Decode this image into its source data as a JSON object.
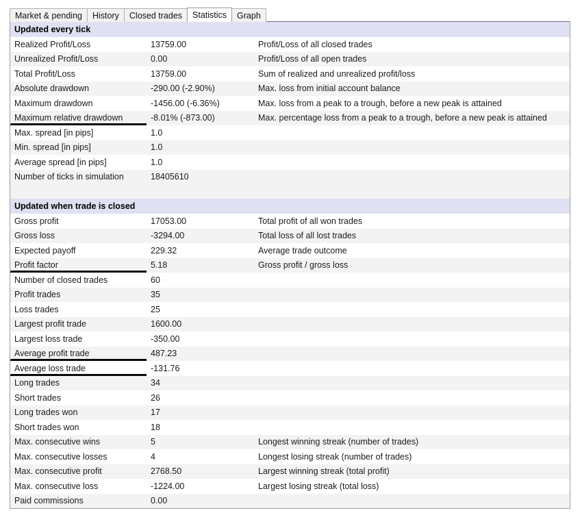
{
  "tabs": [
    {
      "label": "Market & pending",
      "active": false
    },
    {
      "label": "History",
      "active": false
    },
    {
      "label": "Closed trades",
      "active": false
    },
    {
      "label": "Statistics",
      "active": true
    },
    {
      "label": "Graph",
      "active": false
    }
  ],
  "colors": {
    "section_header_bg": "#dfe0f2",
    "row_alt_bg": "#f3f3f3",
    "row_bg": "#ffffff",
    "mark_color": "#0b0b0b",
    "border": "#9e9e9e"
  },
  "rows": [
    {
      "type": "section",
      "name": "Updated every tick",
      "value": "",
      "description": ""
    },
    {
      "type": "data",
      "name": "Realized Profit/Loss",
      "value": "13759.00",
      "description": "Profit/Loss of all closed trades"
    },
    {
      "type": "data",
      "name": "Unrealized Profit/Loss",
      "value": "0.00",
      "description": "Profit/Loss of all open trades"
    },
    {
      "type": "data",
      "name": "Total Profit/Loss",
      "value": "13759.00",
      "description": "Sum of realized and unrealized profit/loss"
    },
    {
      "type": "data",
      "name": "Absolute drawdown",
      "value": "-290.00 (-2.90%)",
      "description": "Max. loss from initial account balance"
    },
    {
      "type": "data",
      "name": "Maximum drawdown",
      "value": "-1456.00 (-6.36%)",
      "description": "Max. loss from a peak to a trough, before a new peak is attained"
    },
    {
      "type": "data",
      "name": "Maximum relative drawdown",
      "value": "-8.01% (-873.00)",
      "description": "Max. percentage loss from a peak to a trough, before a new peak is attained",
      "mark": "u-drawdown"
    },
    {
      "type": "data",
      "name": "Max. spread [in pips]",
      "value": "1.0",
      "description": ""
    },
    {
      "type": "data",
      "name": "Min. spread [in pips]",
      "value": "1.0",
      "description": ""
    },
    {
      "type": "data",
      "name": "Average spread [in pips]",
      "value": "1.0",
      "description": ""
    },
    {
      "type": "data",
      "name": "Number of ticks in simulation",
      "value": "18405610",
      "description": ""
    },
    {
      "type": "spacer",
      "name": "",
      "value": "",
      "description": ""
    },
    {
      "type": "section",
      "name": "Updated when trade is closed",
      "value": "",
      "description": ""
    },
    {
      "type": "data",
      "name": "Gross profit",
      "value": "17053.00",
      "description": "Total profit of all won trades"
    },
    {
      "type": "data",
      "name": "Gross loss",
      "value": "-3294.00",
      "description": "Total loss of all lost trades"
    },
    {
      "type": "data",
      "name": "Expected payoff",
      "value": "229.32",
      "description": "Average trade outcome"
    },
    {
      "type": "data",
      "name": "Profit factor",
      "value": "5.18",
      "description": "Gross profit / gross loss",
      "mark": "u-profitfactor"
    },
    {
      "type": "data",
      "name": "Number of closed trades",
      "value": "60",
      "description": ""
    },
    {
      "type": "data",
      "name": "Profit trades",
      "value": "35",
      "description": ""
    },
    {
      "type": "data",
      "name": "Loss trades",
      "value": "25",
      "description": ""
    },
    {
      "type": "data",
      "name": "Largest profit trade",
      "value": "1600.00",
      "description": ""
    },
    {
      "type": "data",
      "name": "Largest loss trade",
      "value": "-350.00",
      "description": ""
    },
    {
      "type": "data",
      "name": "Average profit trade",
      "value": "487.23",
      "description": "",
      "mark": "u-avgprofit"
    },
    {
      "type": "data",
      "name": "Average loss trade",
      "value": "-131.76",
      "description": "",
      "mark": "u-avgloss"
    },
    {
      "type": "data",
      "name": "Long trades",
      "value": "34",
      "description": ""
    },
    {
      "type": "data",
      "name": "Short trades",
      "value": "26",
      "description": ""
    },
    {
      "type": "data",
      "name": "Long trades won",
      "value": "17",
      "description": ""
    },
    {
      "type": "data",
      "name": "Short trades won",
      "value": "18",
      "description": ""
    },
    {
      "type": "data",
      "name": "Max. consecutive wins",
      "value": "5",
      "description": "Longest winning streak (number of trades)"
    },
    {
      "type": "data",
      "name": "Max. consecutive losses",
      "value": "4",
      "description": "Longest losing streak (number of trades)"
    },
    {
      "type": "data",
      "name": "Max. consecutive profit",
      "value": "2768.50",
      "description": "Largest winning streak (total profit)"
    },
    {
      "type": "data",
      "name": "Max. consecutive loss",
      "value": "-1224.00",
      "description": "Largest losing streak (total loss)"
    },
    {
      "type": "data",
      "name": "Paid commissions",
      "value": "0.00",
      "description": ""
    }
  ]
}
